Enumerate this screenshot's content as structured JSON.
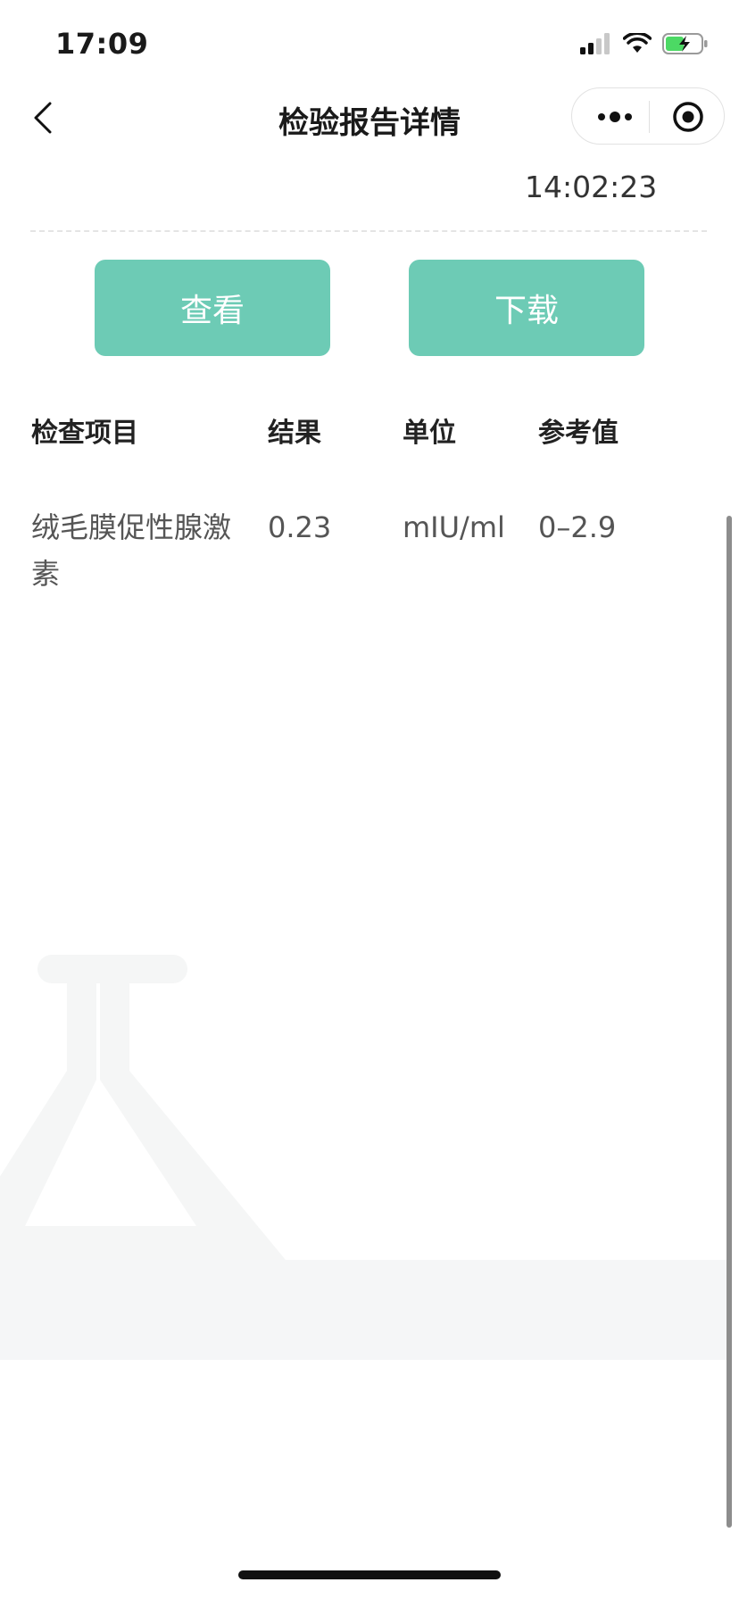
{
  "status_bar": {
    "time": "17:09",
    "icons": [
      "signal-icon",
      "wifi-icon",
      "battery-charging-icon"
    ],
    "battery_color": "#4cd964"
  },
  "nav": {
    "title": "检验报告详情",
    "back_icon": "chevron-left-icon",
    "more_icon": "more-dots-icon",
    "close_icon": "target-circle-icon"
  },
  "report": {
    "time": "14:02:23",
    "view_label": "查看",
    "download_label": "下载",
    "accent_color": "#6dcbb5"
  },
  "table": {
    "headers": [
      "检查项目",
      "结果",
      "单位",
      "参考值"
    ],
    "rows": [
      {
        "item": "绒毛膜促性腺激素",
        "result": "0.23",
        "unit": "mIU/ml",
        "reference": "0–2.9"
      }
    ]
  },
  "decor": {
    "watermark_icon": "flask-watermark-icon"
  }
}
